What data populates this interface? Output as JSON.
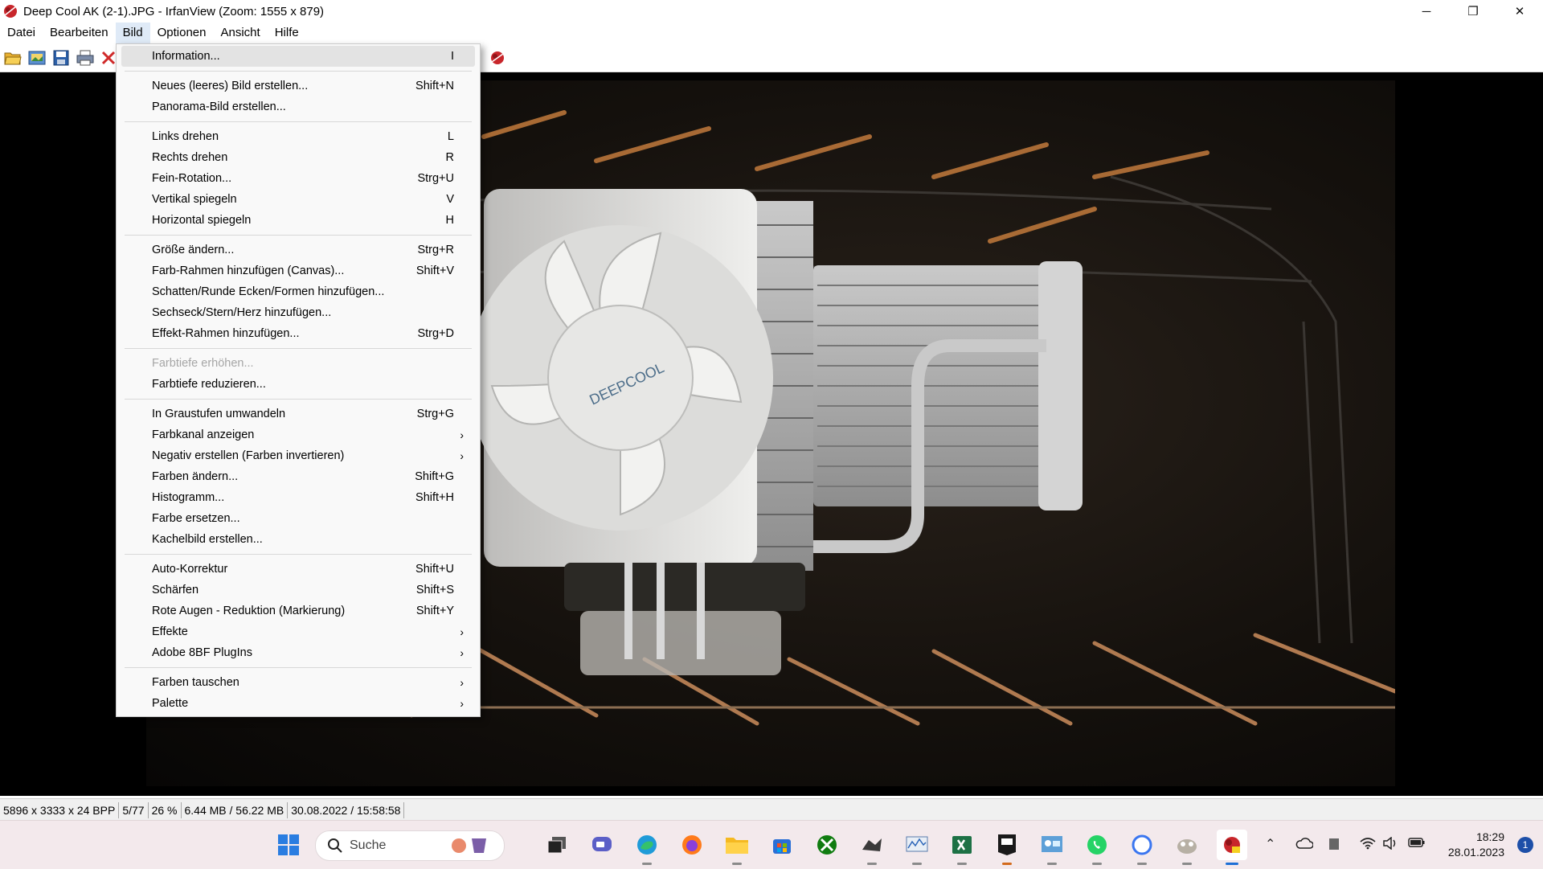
{
  "window": {
    "title": "Deep Cool AK (2-1).JPG - IrfanView (Zoom: 1555 x 879)",
    "controls": {
      "minimize": "─",
      "restore": "❐",
      "close": "✕"
    }
  },
  "menubar": [
    "Datei",
    "Bearbeiten",
    "Bild",
    "Optionen",
    "Ansicht",
    "Hilfe"
  ],
  "menu": {
    "items": [
      {
        "label": "Information...",
        "shortcut": "I"
      },
      {
        "label": "Neues (leeres) Bild erstellen...",
        "shortcut": "Shift+N"
      },
      {
        "label": "Panorama-Bild erstellen...",
        "shortcut": ""
      },
      {
        "label": "Links drehen",
        "shortcut": "L"
      },
      {
        "label": "Rechts drehen",
        "shortcut": "R"
      },
      {
        "label": "Fein-Rotation...",
        "shortcut": "Strg+U"
      },
      {
        "label": "Vertikal spiegeln",
        "shortcut": "V"
      },
      {
        "label": "Horizontal spiegeln",
        "shortcut": "H"
      },
      {
        "label": "Größe ändern...",
        "shortcut": "Strg+R"
      },
      {
        "label": "Farb-Rahmen hinzufügen (Canvas)...",
        "shortcut": "Shift+V"
      },
      {
        "label": "Schatten/Runde Ecken/Formen hinzufügen...",
        "shortcut": ""
      },
      {
        "label": "Sechseck/Stern/Herz hinzufügen...",
        "shortcut": ""
      },
      {
        "label": "Effekt-Rahmen hinzufügen...",
        "shortcut": "Strg+D"
      },
      {
        "label": "Farbtiefe erhöhen...",
        "shortcut": ""
      },
      {
        "label": "Farbtiefe reduzieren...",
        "shortcut": ""
      },
      {
        "label": "In Graustufen umwandeln",
        "shortcut": "Strg+G"
      },
      {
        "label": "Farbkanal anzeigen",
        "shortcut": ""
      },
      {
        "label": "Negativ erstellen (Farben invertieren)",
        "shortcut": ""
      },
      {
        "label": "Farben ändern...",
        "shortcut": "Shift+G"
      },
      {
        "label": "Histogramm...",
        "shortcut": "Shift+H"
      },
      {
        "label": "Farbe ersetzen...",
        "shortcut": ""
      },
      {
        "label": "Kachelbild erstellen...",
        "shortcut": ""
      },
      {
        "label": "Auto-Korrektur",
        "shortcut": "Shift+U"
      },
      {
        "label": "Schärfen",
        "shortcut": "Shift+S"
      },
      {
        "label": "Rote Augen - Reduktion (Markierung)",
        "shortcut": "Shift+Y"
      },
      {
        "label": "Effekte",
        "shortcut": ""
      },
      {
        "label": "Adobe 8BF PlugIns",
        "shortcut": ""
      },
      {
        "label": "Farben tauschen",
        "shortcut": ""
      },
      {
        "label": "Palette",
        "shortcut": ""
      }
    ],
    "submenu_arrow": "›"
  },
  "photo": {
    "logo_text": "DEEPCOOL"
  },
  "statusbar": [
    "5896 x 3333 x 24 BPP",
    "5/77",
    "26 %",
    "6.44 MB / 56.22 MB",
    "30.08.2022 / 15:58:58"
  ],
  "taskbar": {
    "search_label": "Suche",
    "time": "18:29",
    "date": "28.01.2023",
    "notification_count": "1"
  },
  "colors": {
    "menu_bg": "#f9f9f9",
    "menu_hover": "#e3e3e3",
    "disabled_text": "#a6a6a6",
    "taskbar_bg": "#f3e9ec",
    "accent": "#1d4fa8"
  }
}
